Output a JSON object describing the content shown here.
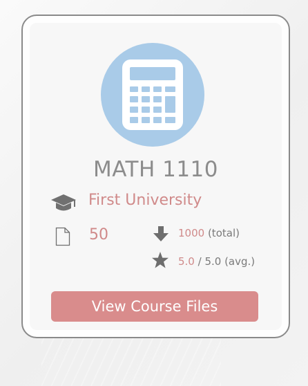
{
  "card": {
    "icon": "calculator-icon",
    "title": "MATH 1110",
    "university": "First University",
    "files_count": "50",
    "downloads": "1000",
    "downloads_suffix": " (total)",
    "rating": "5.0",
    "rating_suffix": " / 5.0 (avg.)",
    "button_label": "View Course Files"
  },
  "colors": {
    "accent": "#d08a8a",
    "button": "#d98c8c",
    "icon_circle": "#a9cbe8",
    "title_text": "#8c8c8c"
  },
  "icons": {
    "university": "graduation-cap-icon",
    "files": "file-icon",
    "downloads": "download-arrow-icon",
    "rating": "star-icon"
  }
}
